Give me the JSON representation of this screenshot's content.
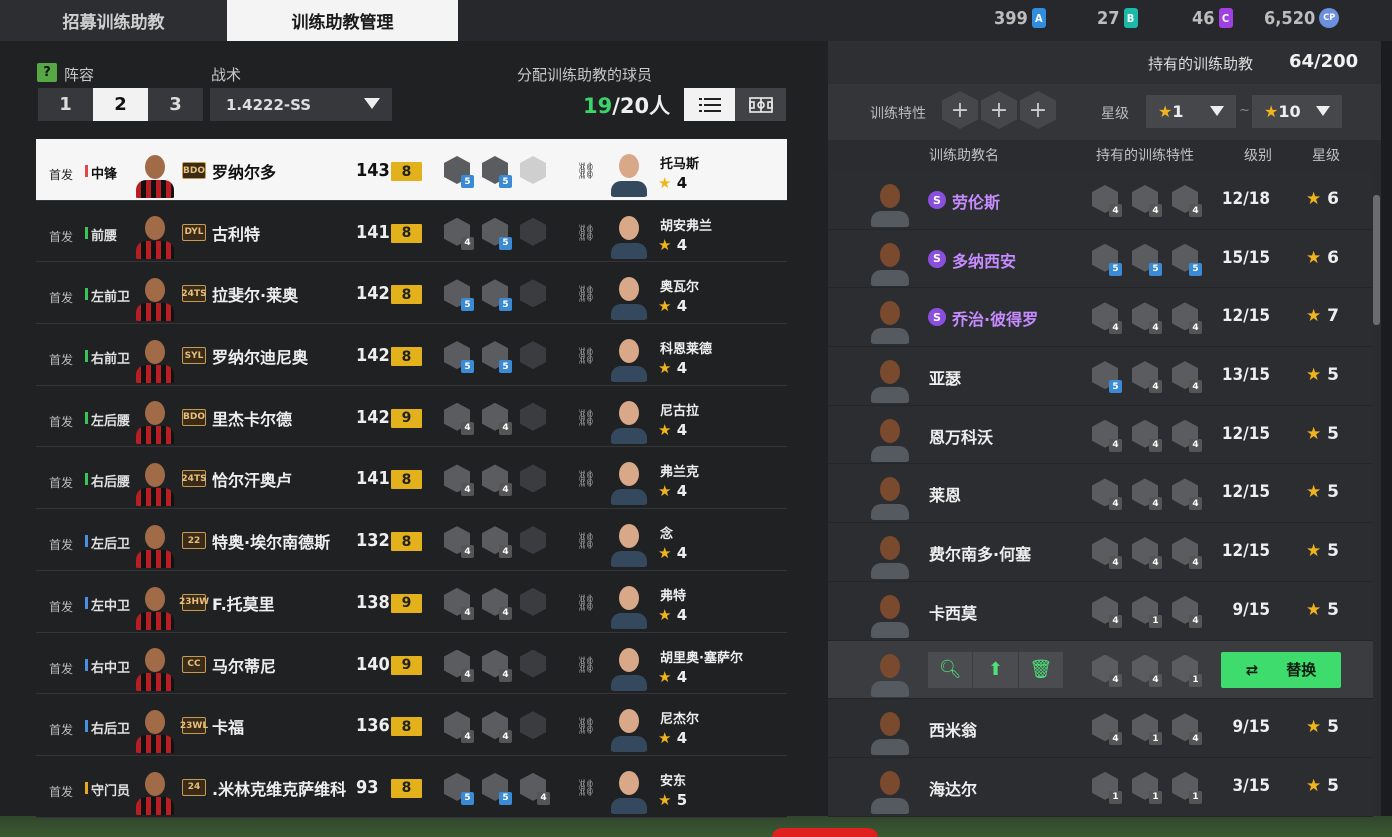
{
  "tabs": [
    "招募训练助教",
    "训练助教管理"
  ],
  "currency": [
    {
      "value": "399",
      "badge": "A",
      "color": "#2f8ee0"
    },
    {
      "value": "27",
      "badge": "B",
      "color": "#1cb8a8"
    },
    {
      "value": "46",
      "badge": "C",
      "color": "#a040e0"
    },
    {
      "value": "6,520",
      "badge": "CP",
      "color": "#6c8fe0"
    }
  ],
  "left": {
    "formation_label": "阵容",
    "help": "?",
    "formation_buttons": [
      "1",
      "2",
      "3"
    ],
    "formation_selected": 1,
    "tactic_label": "战术",
    "tactic_value": "1.4222-SS",
    "assign_label": "分配训练助教的球员",
    "assigned": "19",
    "assigned_total": "/20人"
  },
  "players": [
    {
      "start": "首发",
      "pos": "中锋",
      "posclass": "fw",
      "season": "BDO",
      "name": "罗纳尔多",
      "ovr": "143",
      "lv": "8",
      "traits": [
        {
          "n": "5"
        },
        {
          "n": "5"
        },
        {
          "n": ""
        }
      ],
      "coach": "托马斯",
      "stars": "4"
    },
    {
      "start": "首发",
      "pos": "前腰",
      "posclass": "mf",
      "season": "DYL",
      "name": "古利特",
      "ovr": "141",
      "lv": "8",
      "traits": [
        {
          "n": "4"
        },
        {
          "n": "5"
        },
        {
          "n": ""
        }
      ],
      "coach": "胡安弗兰",
      "stars": "4"
    },
    {
      "start": "首发",
      "pos": "左前卫",
      "posclass": "mf",
      "season": "24TS",
      "name": "拉斐尔·莱奥",
      "ovr": "142",
      "lv": "8",
      "traits": [
        {
          "n": "5"
        },
        {
          "n": "5"
        },
        {
          "n": ""
        }
      ],
      "coach": "奥瓦尔",
      "stars": "4"
    },
    {
      "start": "首发",
      "pos": "右前卫",
      "posclass": "mf",
      "season": "SYL",
      "name": "罗纳尔迪尼奥",
      "ovr": "142",
      "lv": "8",
      "traits": [
        {
          "n": "5"
        },
        {
          "n": "5"
        },
        {
          "n": ""
        }
      ],
      "coach": "科恩莱德",
      "stars": "4"
    },
    {
      "start": "首发",
      "pos": "左后腰",
      "posclass": "mf",
      "season": "BDO",
      "name": "里杰卡尔德",
      "ovr": "142",
      "lv": "9",
      "traits": [
        {
          "n": "4"
        },
        {
          "n": "4"
        },
        {
          "n": ""
        }
      ],
      "coach": "尼古拉",
      "stars": "4"
    },
    {
      "start": "首发",
      "pos": "右后腰",
      "posclass": "mf",
      "season": "24TS",
      "name": "恰尔汗奥卢",
      "ovr": "141",
      "lv": "8",
      "traits": [
        {
          "n": "4"
        },
        {
          "n": "4"
        },
        {
          "n": ""
        }
      ],
      "coach": "弗兰克",
      "stars": "4"
    },
    {
      "start": "首发",
      "pos": "左后卫",
      "posclass": "df",
      "season": "22",
      "name": "特奥·埃尔南德斯",
      "ovr": "132",
      "lv": "8",
      "traits": [
        {
          "n": "4"
        },
        {
          "n": "4"
        },
        {
          "n": ""
        }
      ],
      "coach": "念",
      "stars": "4"
    },
    {
      "start": "首发",
      "pos": "左中卫",
      "posclass": "df",
      "season": "23HW",
      "name": "F.托莫里",
      "ovr": "138",
      "lv": "9",
      "traits": [
        {
          "n": "4"
        },
        {
          "n": "4"
        },
        {
          "n": ""
        }
      ],
      "coach": "弗特",
      "stars": "4"
    },
    {
      "start": "首发",
      "pos": "右中卫",
      "posclass": "df",
      "season": "CC",
      "name": "马尔蒂尼",
      "ovr": "140",
      "lv": "9",
      "traits": [
        {
          "n": "4"
        },
        {
          "n": "4"
        },
        {
          "n": ""
        }
      ],
      "coach": "胡里奥·塞萨尔",
      "stars": "4"
    },
    {
      "start": "首发",
      "pos": "右后卫",
      "posclass": "df",
      "season": "23WL",
      "name": "卡福",
      "ovr": "136",
      "lv": "8",
      "traits": [
        {
          "n": "4"
        },
        {
          "n": "4"
        },
        {
          "n": ""
        }
      ],
      "coach": "尼杰尔",
      "stars": "4"
    },
    {
      "start": "首发",
      "pos": "守门员",
      "posclass": "gk",
      "season": "24",
      "name": ".米林克维克萨维科",
      "ovr": "93",
      "lv": "8",
      "traits": [
        {
          "n": "5"
        },
        {
          "n": "5"
        },
        {
          "n": "4"
        }
      ],
      "coach": "安东",
      "stars": "5"
    }
  ],
  "right": {
    "owned_label": "持有的训练助教",
    "owned_value": "64/200",
    "trait_filter_label": "训练特性",
    "grade_filter_label": "星级",
    "grade_from": "1",
    "grade_sep": "~",
    "grade_to": "10",
    "col_name": "训练助教名",
    "col_traits": "持有的训练特性",
    "col_level": "级别",
    "col_grade": "星级",
    "replace_label": "替换"
  },
  "coaches": [
    {
      "name": "劳伦斯",
      "special": true,
      "traits": [
        "4",
        "4",
        "4"
      ],
      "level": "12/18",
      "grade": "6"
    },
    {
      "name": "多纳西安",
      "special": true,
      "traits": [
        "5",
        "5",
        "5"
      ],
      "level": "15/15",
      "grade": "6"
    },
    {
      "name": "乔治·彼得罗",
      "special": true,
      "traits": [
        "4",
        "4",
        "4"
      ],
      "level": "12/15",
      "grade": "7"
    },
    {
      "name": "亚瑟",
      "special": false,
      "traits": [
        "5",
        "4",
        "4"
      ],
      "level": "13/15",
      "grade": "5"
    },
    {
      "name": "恩万科沃",
      "special": false,
      "traits": [
        "4",
        "4",
        "4"
      ],
      "level": "12/15",
      "grade": "5"
    },
    {
      "name": "莱恩",
      "special": false,
      "traits": [
        "4",
        "4",
        "4"
      ],
      "level": "12/15",
      "grade": "5"
    },
    {
      "name": "费尔南多·何塞",
      "special": false,
      "traits": [
        "4",
        "4",
        "4"
      ],
      "level": "12/15",
      "grade": "5"
    },
    {
      "name": "卡西莫",
      "special": false,
      "traits": [
        "4",
        "1",
        "4"
      ],
      "level": "9/15",
      "grade": "5"
    },
    {
      "name": "",
      "special": false,
      "selected": true,
      "traits": [
        "4",
        "4",
        "1"
      ],
      "level": "",
      "grade": ""
    },
    {
      "name": "西米翁",
      "special": false,
      "traits": [
        "4",
        "1",
        "4"
      ],
      "level": "9/15",
      "grade": "5"
    },
    {
      "name": "海达尔",
      "special": false,
      "traits": [
        "1",
        "1",
        "1"
      ],
      "level": "3/15",
      "grade": "5"
    }
  ]
}
